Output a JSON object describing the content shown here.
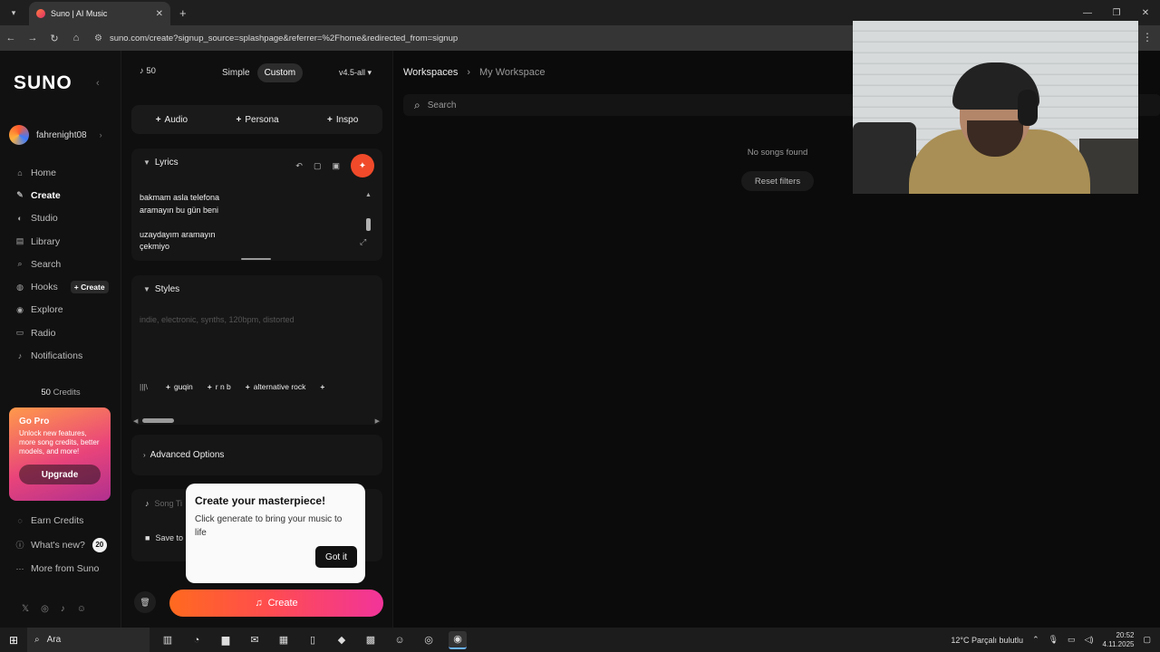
{
  "browser": {
    "tab_title": "Suno | AI Music",
    "url": "suno.com/create?signup_source=splashpage&referrer=%2Fhome&redirected_from=signup"
  },
  "sidebar": {
    "logo": "SUNO",
    "username": "fahrenight08",
    "nav": [
      {
        "label": "Home",
        "icon": "home-icon"
      },
      {
        "label": "Create",
        "icon": "create-icon"
      },
      {
        "label": "Studio",
        "icon": "studio-icon"
      },
      {
        "label": "Library",
        "icon": "library-icon"
      },
      {
        "label": "Search",
        "icon": "search-icon"
      },
      {
        "label": "Hooks",
        "icon": "hooks-icon",
        "pill": "+ Create"
      },
      {
        "label": "Explore",
        "icon": "explore-icon"
      },
      {
        "label": "Radio",
        "icon": "radio-icon"
      },
      {
        "label": "Notifications",
        "icon": "bell-icon"
      }
    ],
    "credits_count": "50",
    "credits_label": "Credits",
    "gopro": {
      "title": "Go Pro",
      "description": "Unlock new features, more song credits, better models, and more!",
      "button": "Upgrade"
    },
    "bottom_nav": [
      {
        "label": "Earn Credits",
        "icon": "earn-icon"
      },
      {
        "label": "What's new?",
        "icon": "info-icon",
        "badge": "20"
      },
      {
        "label": "More from Suno",
        "icon": "more-icon"
      }
    ]
  },
  "create": {
    "credits": "50",
    "mode_simple": "Simple",
    "mode_custom": "Custom",
    "model": "v4.5-all",
    "add_audio": "Audio",
    "add_persona": "Persona",
    "add_inspo": "Inspo",
    "lyrics_title": "Lyrics",
    "lyrics_text": "bakmam asla telefona\naramayın bu gün beni\n\nuzaydayım aramayın\nçekmiyo",
    "styles_title": "Styles",
    "styles_placeholder": "indie, electronic, synths, 120bpm, distorted",
    "style_chips": [
      "guqin",
      "r n b",
      "alternative rock"
    ],
    "advanced_title": "Advanced Options",
    "song_title_placeholder": "Song Ti",
    "save_to": "Save to",
    "create_button": "Create"
  },
  "popover": {
    "title": "Create your masterpiece!",
    "description": "Click generate to bring your music to life",
    "button": "Got it"
  },
  "workspace": {
    "crumb_root": "Workspaces",
    "crumb_current": "My Workspace",
    "search_placeholder": "Search",
    "empty_text": "No songs found",
    "reset_button": "Reset filters"
  },
  "taskbar": {
    "search_label": "Ara",
    "weather": "12°C  Parçalı bulutlu",
    "time": "20:52",
    "date": "4.11.2025"
  }
}
